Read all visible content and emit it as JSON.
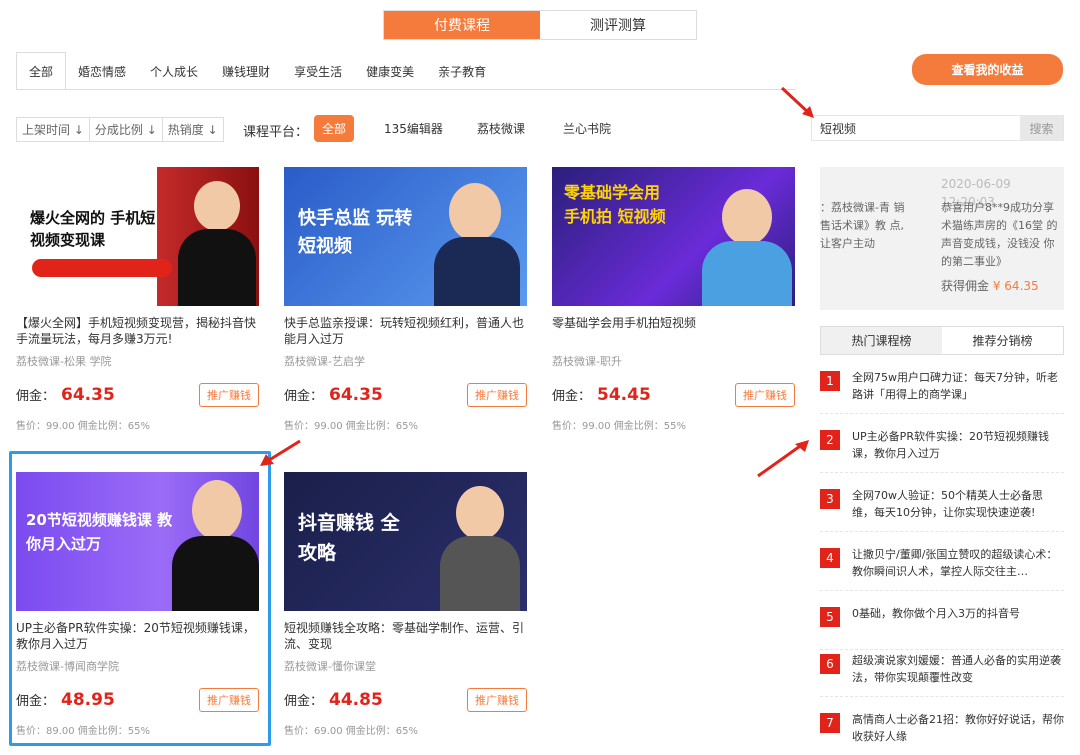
{
  "top_tabs": [
    {
      "label": "付费课程"
    },
    {
      "label": "测评测算"
    }
  ],
  "categories": [
    {
      "label": "全部"
    },
    {
      "label": "婚恋情感"
    },
    {
      "label": "个人成长"
    },
    {
      "label": "赚钱理财"
    },
    {
      "label": "享受生活"
    },
    {
      "label": "健康变美"
    },
    {
      "label": "亲子教育"
    }
  ],
  "earnings_button": "查看我的收益",
  "sort": [
    {
      "label": "上架时间 ↓"
    },
    {
      "label": "分成比例 ↓"
    },
    {
      "label": "热销度 ↓"
    }
  ],
  "platform_label": "课程平台：",
  "platforms": [
    {
      "label": "全部"
    },
    {
      "label": "135编辑器"
    },
    {
      "label": "荔枝微课"
    },
    {
      "label": "兰心书院"
    }
  ],
  "search": {
    "value": "短视频",
    "button": "搜索"
  },
  "commission_label": "佣金：",
  "promo_label": "推广赚钱",
  "cards": [
    {
      "title": "【爆火全网】手机短视频变现营，揭秘抖音快手流量玩法，每月多赚3万元!",
      "source": "荔枝微课-松果 学院",
      "commission": "64.35",
      "footer": "售价：99.00 佣金比例：65%",
      "thumb_text": "爆火全网的 手机短视频变现课"
    },
    {
      "title": "快手总监亲授课：玩转短视频红利，普通人也能月入过万",
      "source": "荔枝微课-艺启学",
      "commission": "64.35",
      "footer": "售价：99.00 佣金比例：65%",
      "thumb_text": "快手总监 玩转短视频"
    },
    {
      "title": "零基础学会用手机拍短视频",
      "source": "荔枝微课-职升",
      "commission": "54.45",
      "footer": "售价：99.00 佣金比例：55%",
      "thumb_text": "零基础学会用手机拍 短视频"
    },
    {
      "title": "UP主必备PR软件实操：20节短视频赚钱课，教你月入过万",
      "source": "荔枝微课-博闻商学院",
      "commission": "48.95",
      "footer": "售价：89.00 佣金比例：55%",
      "thumb_text": "20节短视频赚钱课 教你月入过万"
    },
    {
      "title": "短视频赚钱全攻略：零基础学制作、运营、引流、变现",
      "source": "荔枝微课-懂你课堂",
      "commission": "44.85",
      "footer": "售价：69.00 佣金比例：65%",
      "thumb_text": "抖音赚钱 全攻略"
    }
  ],
  "promo_panel": {
    "date": "2020-06-09 12:20:03",
    "left_text": "：荔枝微课-青 销售话术课》教 点,让客户主动",
    "right_text": "恭喜用户8**9成功分享 术猫练声房的《16堂 的声音变成钱，没钱没 你的第二事业》",
    "earn_label": "获得佣金",
    "earn_value": "¥ 64.35"
  },
  "rank_tabs": [
    {
      "label": "热门课程榜"
    },
    {
      "label": "推荐分销榜"
    }
  ],
  "ranking": [
    {
      "num": "1",
      "text": "全网75w用户口碑力证：每天7分钟，听老路讲「用得上的商学课」"
    },
    {
      "num": "2",
      "text": "UP主必备PR软件实操：20节短视频赚钱课，教你月入过万"
    },
    {
      "num": "3",
      "text": "全网70w人验证：50个精英人士必备思维，每天10分钟，让你实现快速逆袭!"
    },
    {
      "num": "4",
      "text": "让撒贝宁/董卿/张国立赞叹的超级读心术：教你瞬间识人术，掌控人际交往主…"
    },
    {
      "num": "5",
      "text": "0基础，教你做个月入3万的抖音号"
    },
    {
      "num": "6",
      "text": "超级演说家刘媛媛：普通人必备的实用逆袭法，带你实现颠覆性改变"
    },
    {
      "num": "7",
      "text": "高情商人士必备21招：教你好好说话，帮你收获好人缘"
    }
  ],
  "colors": {
    "accent": "#f47b3c",
    "price": "#e2231a",
    "highlight": "#2e9bea"
  }
}
